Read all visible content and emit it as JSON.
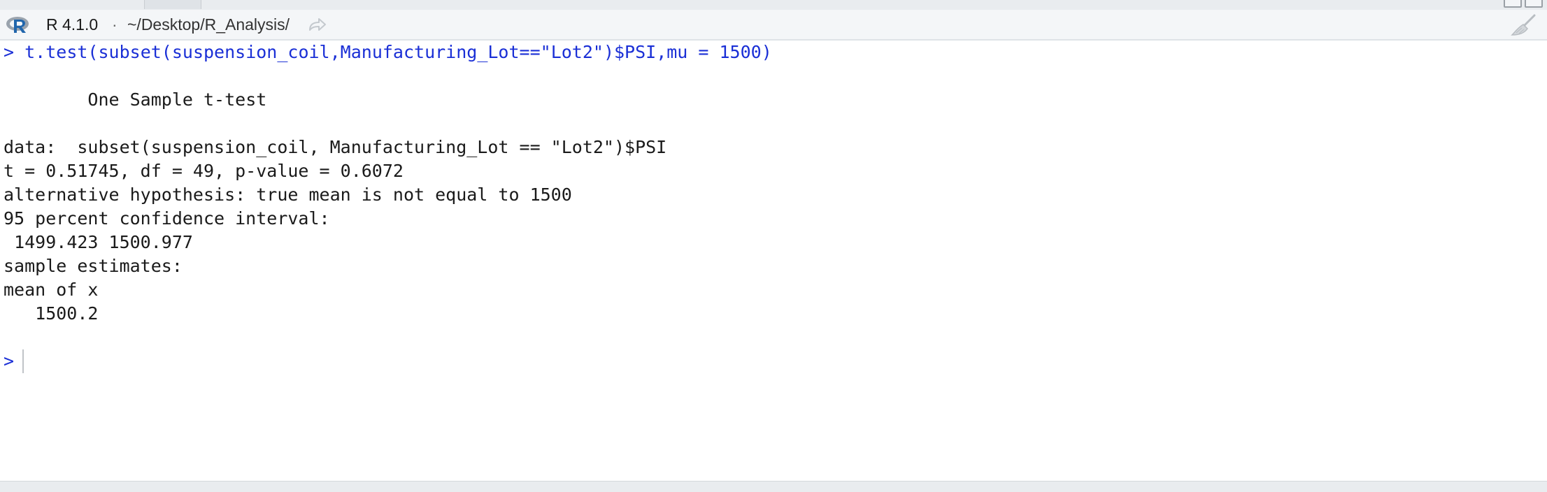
{
  "header": {
    "version": "R 4.1.0",
    "separator": "·",
    "path": "~/Desktop/R_Analysis/"
  },
  "icons": {
    "r_logo": "r-logo-icon",
    "goto_directory": "goto-directory-icon",
    "clear_console": "broom-icon"
  },
  "console": {
    "prompt": ">",
    "command": "t.test(subset(suspension_coil,Manufacturing_Lot==\"Lot2\")$PSI,mu = 1500)",
    "title": "One Sample t-test",
    "data_line": "data:  subset(suspension_coil, Manufacturing_Lot == \"Lot2\")$PSI",
    "stat_line": "t = 0.51745, df = 49, p-value = 0.6072",
    "alt_line": "alternative hypothesis: true mean is not equal to 1500",
    "ci_label": "95 percent confidence interval:",
    "ci_values": "1499.423 1500.977",
    "estimates_label": "sample estimates:",
    "estimate_name": "mean of x",
    "estimate_value": "1500.2",
    "input_prompt": ">"
  },
  "colors": {
    "command": "#1a2fd6",
    "output": "#1a1a1a",
    "header_bg": "#f4f6f8"
  }
}
